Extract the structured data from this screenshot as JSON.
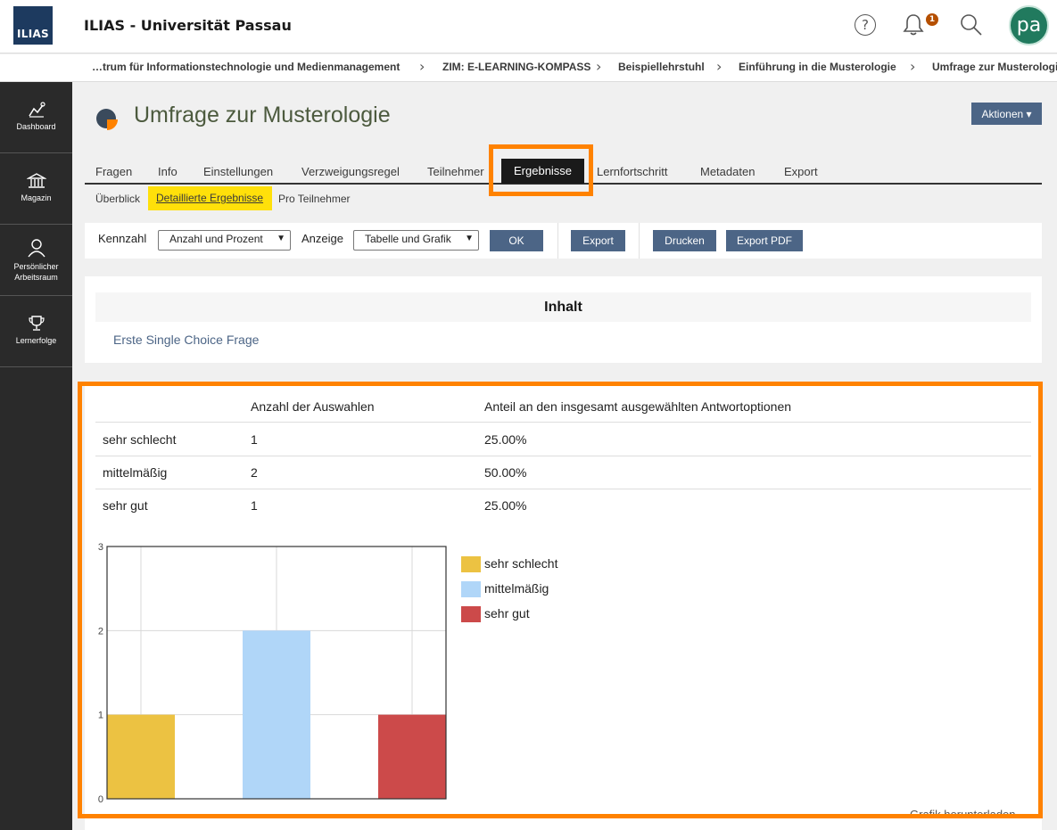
{
  "header": {
    "logo_text": "ILIAS",
    "site_title": "ILIAS - Universität Passau",
    "notification_count": "1",
    "avatar_initials": "pa"
  },
  "breadcrumb": [
    "…trum für Informationstechnologie und Medienmanagement",
    "ZIM: E-LEARNING-KOMPASS",
    "Beispiellehrstuhl",
    "Einführung in die Musterologie",
    "Umfrage zur Musterologie"
  ],
  "sidebar": [
    {
      "label": "Dashboard",
      "icon": "dashboard-icon"
    },
    {
      "label": "Magazin",
      "icon": "bank-icon"
    },
    {
      "label": "Persönlicher Arbeitsraum",
      "icon": "user-icon"
    },
    {
      "label": "Lernerfolge",
      "icon": "trophy-icon"
    }
  ],
  "page": {
    "title": "Umfrage zur Musterologie",
    "actions_label": "Aktionen ▾"
  },
  "tabs": [
    "Fragen",
    "Info",
    "Einstellungen",
    "Verzweigungsregel",
    "Teilnehmer",
    "Ergebnisse",
    "Lernfortschritt",
    "Metadaten",
    "Export"
  ],
  "active_tab": "Ergebnisse",
  "subtabs": [
    "Überblick",
    "Detaillierte Ergebnisse",
    "Pro Teilnehmer"
  ],
  "toolbar": {
    "kennzahl_label": "Kennzahl",
    "kennzahl_value": "Anzahl und Prozent",
    "anzeige_label": "Anzeige",
    "anzeige_value": "Tabelle und Grafik",
    "ok": "OK",
    "export": "Export",
    "print": "Drucken",
    "export_pdf": "Export PDF"
  },
  "contents": {
    "heading": "Inhalt",
    "link": "Erste Single Choice Frage"
  },
  "results": {
    "col_count": "Anzahl der Auswahlen",
    "col_share": "Anteil an den insgesamt ausgewählten Antwortoptionen",
    "rows": [
      {
        "label": "sehr schlecht",
        "count": "1",
        "share": "25.00%"
      },
      {
        "label": "mittelmäßig",
        "count": "2",
        "share": "50.00%"
      },
      {
        "label": "sehr gut",
        "count": "1",
        "share": "25.00%"
      }
    ]
  },
  "chart_data": {
    "type": "bar",
    "categories": [
      "sehr schlecht",
      "mittelmäßig",
      "sehr gut"
    ],
    "values": [
      1,
      2,
      1
    ],
    "colors": [
      "#ecc242",
      "#b0d6f8",
      "#cc4a4a"
    ],
    "ylim": [
      0,
      3
    ],
    "yticks": [
      "0",
      "1",
      "2",
      "3"
    ],
    "grid": true,
    "legend": "right"
  },
  "footer_cut_text": "Grafik herunterladen"
}
